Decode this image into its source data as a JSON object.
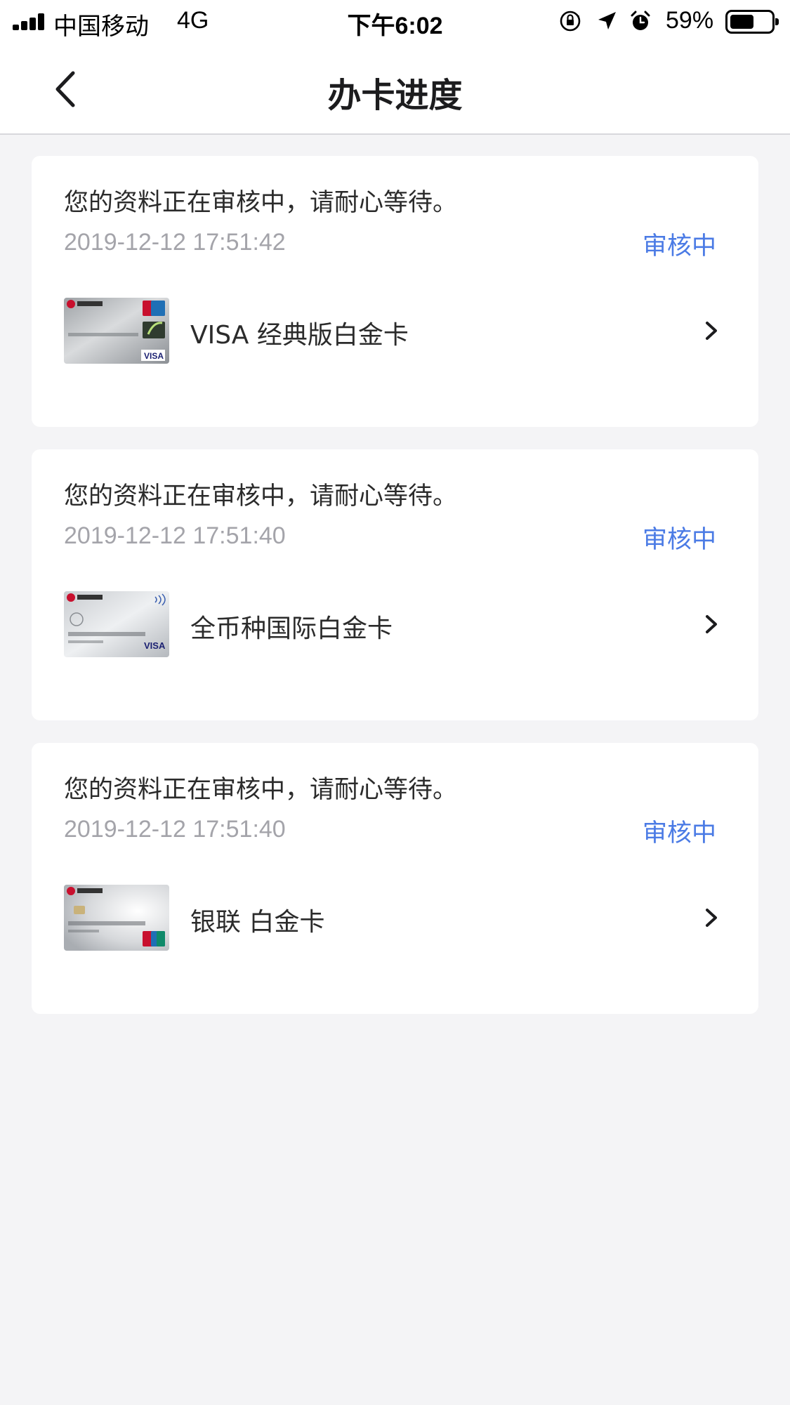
{
  "status_bar": {
    "carrier": "中国移动",
    "network": "4G",
    "time": "下午6:02",
    "battery": "59%",
    "battery_level": 0.59,
    "icons": [
      "signal-icon",
      "orientation-lock-icon",
      "location-icon",
      "alarm-icon",
      "battery-icon"
    ]
  },
  "nav": {
    "title": "办卡进度",
    "back_icon": "chevron-left-icon"
  },
  "applications": [
    {
      "message": "您的资料正在审核中，请耐心等待。",
      "timestamp": "2019-12-12 17:51:42",
      "status": "审核中",
      "card_name": "VISA 经典版白金卡",
      "card_image": "visa-classic-platinum-card-image"
    },
    {
      "message": "您的资料正在审核中，请耐心等待。",
      "timestamp": "2019-12-12 17:51:40",
      "status": "审核中",
      "card_name": "全币种国际白金卡",
      "card_image": "multi-currency-platinum-card-image"
    },
    {
      "message": "您的资料正在审核中，请耐心等待。",
      "timestamp": "2019-12-12 17:51:40",
      "status": "审核中",
      "card_name": "银联 白金卡",
      "card_image": "unionpay-platinum-card-image"
    }
  ],
  "colors": {
    "accent": "#4b7be5",
    "background": "#f4f4f6",
    "card": "#ffffff",
    "timestamp": "#a4a4aa"
  }
}
